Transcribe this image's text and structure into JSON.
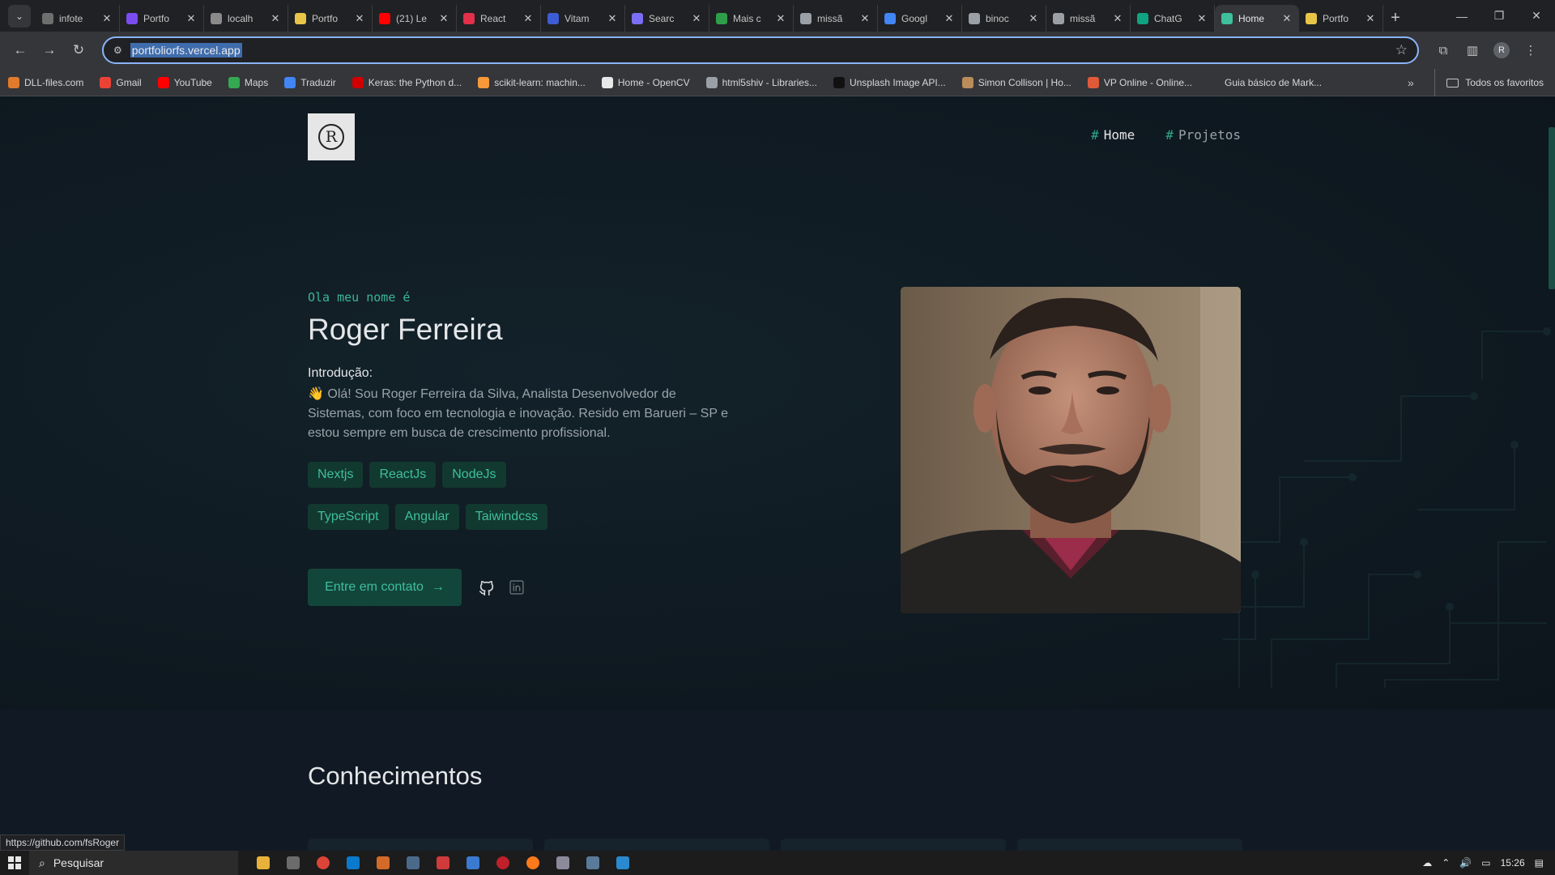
{
  "browser": {
    "tabs": [
      {
        "label": "infote",
        "color": "#6e6e6e"
      },
      {
        "label": "Portfo",
        "color": "#7b4cf0"
      },
      {
        "label": "localh",
        "color": "#8a8a8a"
      },
      {
        "label": "Portfo",
        "color": "#e8c547"
      },
      {
        "label": "(21) Le",
        "color": "#ff0000"
      },
      {
        "label": "React",
        "color": "#e2304b"
      },
      {
        "label": "Vitam",
        "color": "#3d5dd6"
      },
      {
        "label": "Searc",
        "color": "#7b6ef6"
      },
      {
        "label": "Mais c",
        "color": "#2e9e4a"
      },
      {
        "label": "missã",
        "color": "#9aa0a6"
      },
      {
        "label": "Googl",
        "color": "#4285f4"
      },
      {
        "label": "binoc",
        "color": "#9aa0a6"
      },
      {
        "label": "missã",
        "color": "#9aa0a6"
      },
      {
        "label": "ChatG",
        "color": "#10a37f"
      },
      {
        "label": "Home",
        "color": "#3fbf9c",
        "active": true
      },
      {
        "label": "Portfo",
        "color": "#e8c547"
      }
    ],
    "url": "portfoliorfs.vercel.app",
    "bookmarks": [
      {
        "label": "DLL-files.com",
        "color": "#e07b2b"
      },
      {
        "label": "Gmail",
        "color": "#ea4335"
      },
      {
        "label": "YouTube",
        "color": "#ff0000"
      },
      {
        "label": "Maps",
        "color": "#34a853"
      },
      {
        "label": "Traduzir",
        "color": "#4285f4"
      },
      {
        "label": "Keras: the Python d...",
        "color": "#d00000"
      },
      {
        "label": "scikit-learn: machin...",
        "color": "#f89939"
      },
      {
        "label": "Home - OpenCV",
        "color": "#e8e8e8"
      },
      {
        "label": "html5shiv - Libraries...",
        "color": "#9aa0a6"
      },
      {
        "label": "Unsplash Image API...",
        "color": "#111111"
      },
      {
        "label": "Simon Collison | Ho...",
        "color": "#b98c5a"
      },
      {
        "label": "VP Online - Online...",
        "color": "#e05a3a"
      },
      {
        "label": "Guia básico de Mark...",
        "color": "#35363a"
      }
    ],
    "all_bookmarks": "Todos os favoritos",
    "status_link": "https://github.com/fsRoger"
  },
  "site": {
    "logo_letter": "R",
    "nav": [
      {
        "hash": "#",
        "label": "Home"
      },
      {
        "hash": "#",
        "label": "Projetos"
      }
    ],
    "greeting": "Ola meu nome é",
    "name": "Roger Ferreira",
    "intro_label": "Introdução:",
    "intro_text": "👋 Olá! Sou Roger Ferreira da Silva, Analista Desenvolvedor de Sistemas, com foco em tecnologia e inovação. Resido em Barueri – SP e estou sempre em busca de crescimento profissional.",
    "tags_row1": [
      "Nextjs",
      "ReactJs",
      "NodeJs"
    ],
    "tags_row2": [
      "TypeScript",
      "Angular",
      "Taiwindcss"
    ],
    "cta_label": "Entre em contato",
    "cta_arrow": "→",
    "section_title": "Conhecimentos",
    "accent": "#3fbf9c"
  },
  "taskbar": {
    "search_placeholder": "Pesquisar",
    "time": "15:26"
  }
}
